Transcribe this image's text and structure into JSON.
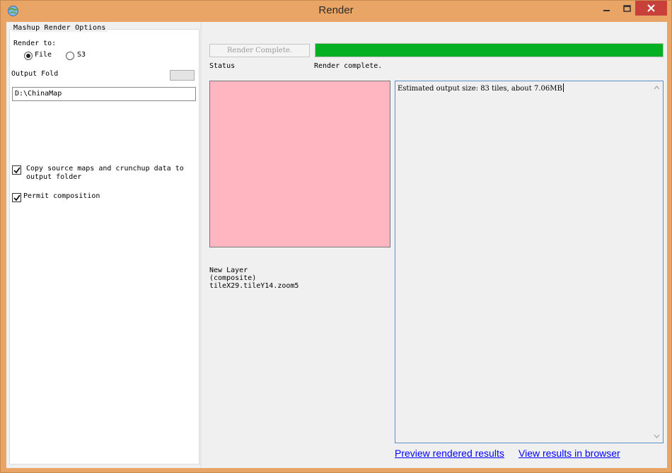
{
  "window": {
    "title": "Render"
  },
  "left": {
    "group_title": "Mashup Render Options",
    "render_to_label": "Render to:",
    "radio_file": "File",
    "radio_s3": "S3",
    "output_folder_label": "Output Fold",
    "output_folder_value": "D:\\ChinaMap",
    "copy_label_line1": "Copy source maps and crunchup data to",
    "copy_label_line2": "output folder",
    "permit_label": "Permit composition"
  },
  "right": {
    "render_button": "Render Complete.",
    "status_label": "Status",
    "status_value": "Render complete.",
    "progress_percent": 100,
    "preview_color": "#ffb6c1",
    "layer_line1": "New Layer",
    "layer_line2": "(composite)",
    "layer_line3": "tileX29.tileY14.zoom5",
    "output_text": "Estimated output size: 83 tiles, about 7.06MB",
    "link_preview": "Preview rendered results",
    "link_browser": "View results in browser"
  },
  "colors": {
    "titlebar": "#e9a565",
    "progress": "#06b025",
    "close": "#c7403a",
    "link": "#0000ff"
  }
}
